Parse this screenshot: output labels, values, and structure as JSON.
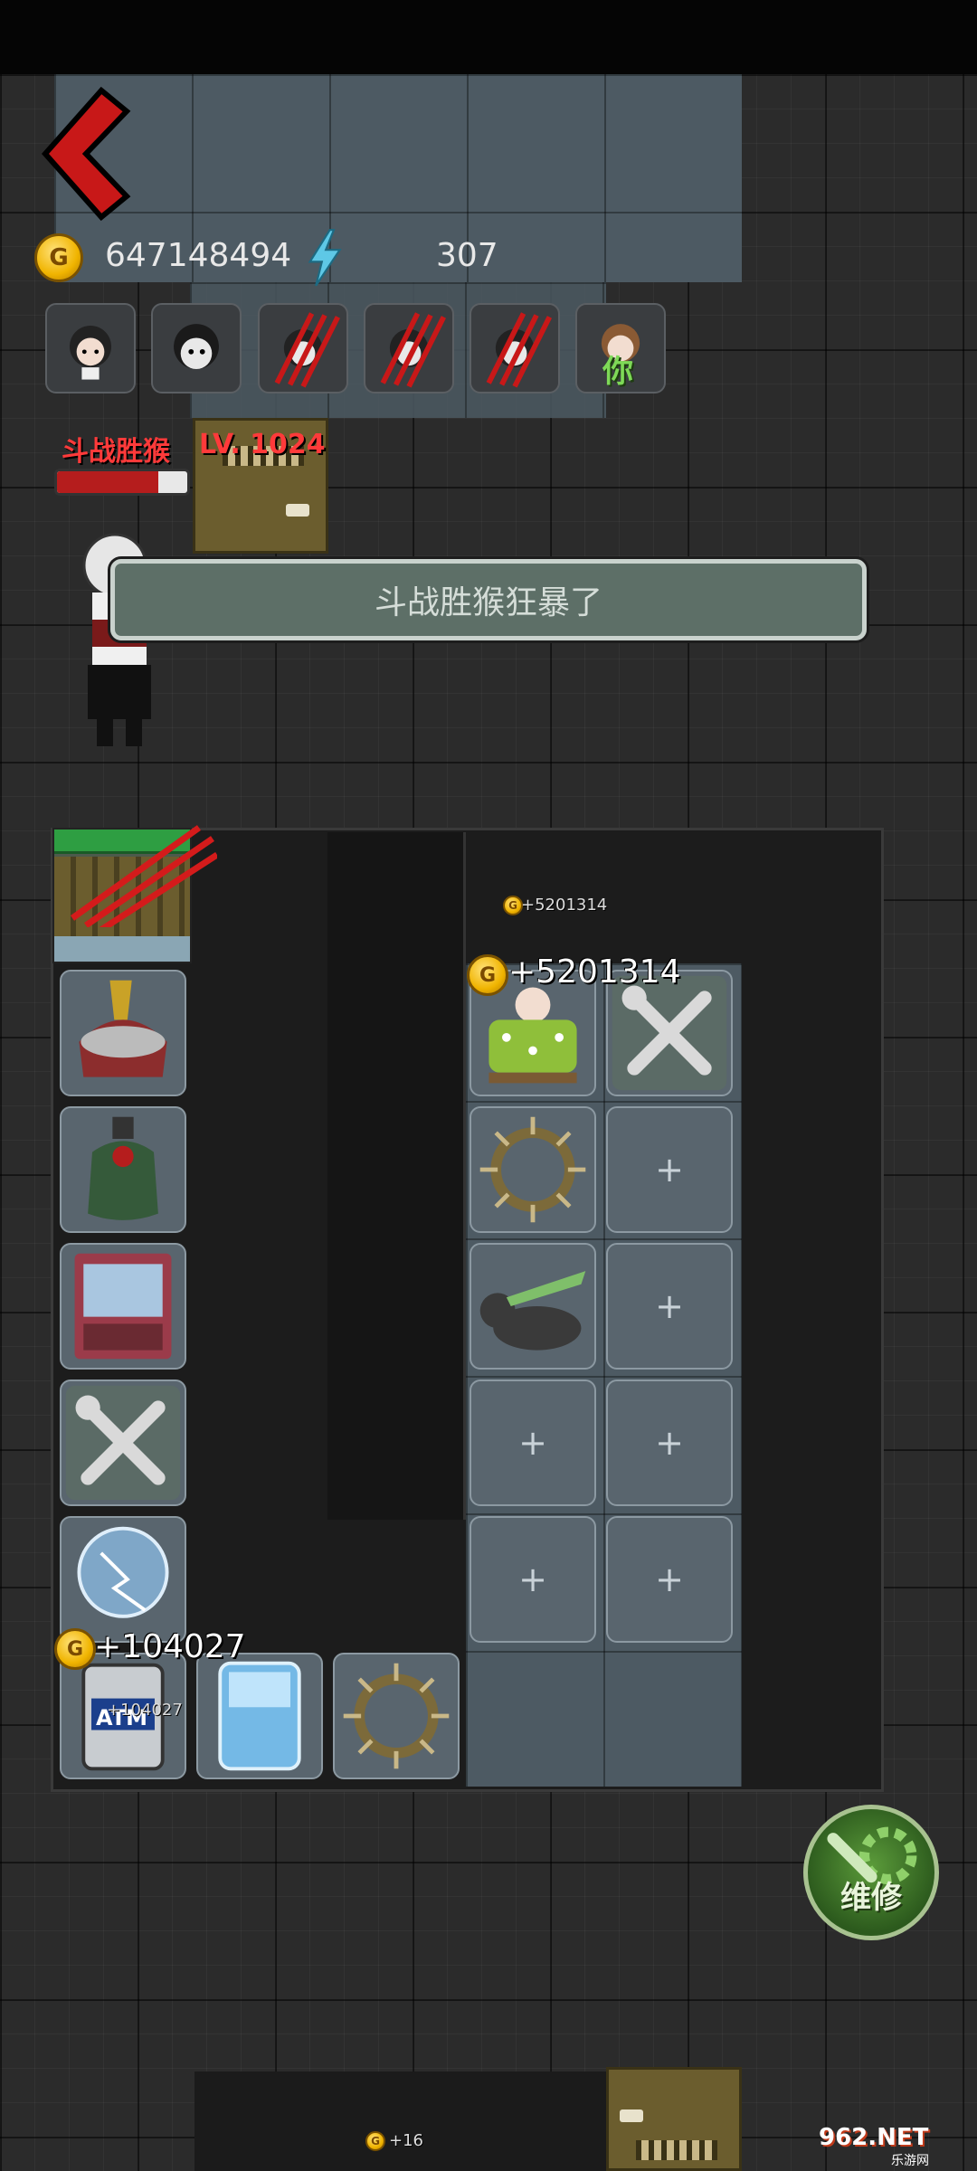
{
  "hud": {
    "gold_amount": "647148494",
    "energy_amount": "307",
    "coin_symbol": "G"
  },
  "players": [
    {
      "id": "p1",
      "label": ""
    },
    {
      "id": "p2",
      "label": ""
    },
    {
      "id": "p3",
      "label": ""
    },
    {
      "id": "p4",
      "label": ""
    },
    {
      "id": "p5",
      "label": ""
    },
    {
      "id": "p6",
      "label": "你"
    }
  ],
  "boss": {
    "name": "斗战胜猴",
    "level": "LV. 1024",
    "hp_fraction": 0.78
  },
  "notification": {
    "message": "斗战胜猴狂暴了"
  },
  "gold_popups": {
    "room_small": "+5201314",
    "room_large": "+5201314",
    "atm_large": "+104027",
    "atm_small": "+104027",
    "bottom_small": "+16"
  },
  "slot_plus": "+",
  "atm_label": "ATM",
  "repair_button": {
    "label": "维修"
  },
  "watermark": {
    "text": "962.NET",
    "sub": "乐游网"
  },
  "colors": {
    "boss_red": "#ff3a3a",
    "banner_bg": "#5d6f67",
    "slot_bg": "#59656e",
    "repair_green": "#2c5a1d"
  }
}
